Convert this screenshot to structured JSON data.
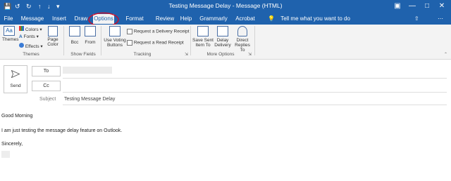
{
  "window": {
    "title": "Testing Message Delay  -  Message (HTML)"
  },
  "quick_access": {
    "icons": [
      "save-icon",
      "undo-icon",
      "redo-icon",
      "up-arrow-icon",
      "down-arrow-icon",
      "customize-icon"
    ]
  },
  "tabs": [
    {
      "label": "File"
    },
    {
      "label": "Message"
    },
    {
      "label": "Insert"
    },
    {
      "label": "Draw"
    },
    {
      "label": "Options"
    },
    {
      "label": "Format Text"
    },
    {
      "label": "Review"
    },
    {
      "label": "Help"
    },
    {
      "label": "Grammarly"
    },
    {
      "label": "Acrobat"
    }
  ],
  "active_tab": "Options",
  "tell_me": "Tell me what you want to do",
  "ribbon": {
    "themes": {
      "label": "Themes",
      "colors": "Colors",
      "fonts": "Fonts",
      "effects": "Effects",
      "page_color_1": "Page",
      "page_color_2": "Color",
      "group": "Themes"
    },
    "show_fields": {
      "bcc": "Bcc",
      "from": "From",
      "group": "Show Fields"
    },
    "tracking": {
      "voting_1": "Use Voting",
      "voting_2": "Buttons",
      "delivery": "Request a Delivery Receipt",
      "read": "Request a Read Receipt",
      "group": "Tracking"
    },
    "more_options": {
      "save_sent_1": "Save Sent",
      "save_sent_2": "Item To",
      "delay_1": "Delay",
      "delay_2": "Delivery",
      "direct_1": "Direct",
      "direct_2": "Replies To",
      "group": "More Options"
    }
  },
  "compose": {
    "send": "Send",
    "to": "To",
    "cc": "Cc",
    "subject_label": "Subject",
    "subject_value": "Testing Message Delay"
  },
  "body": {
    "line1": "Good Morning",
    "line2": "I am just testing the message delay feature on Outlook.",
    "line3": "Sincerely,"
  },
  "colors": {
    "accent": "#1f62ad",
    "highlight": "#c8102e"
  }
}
